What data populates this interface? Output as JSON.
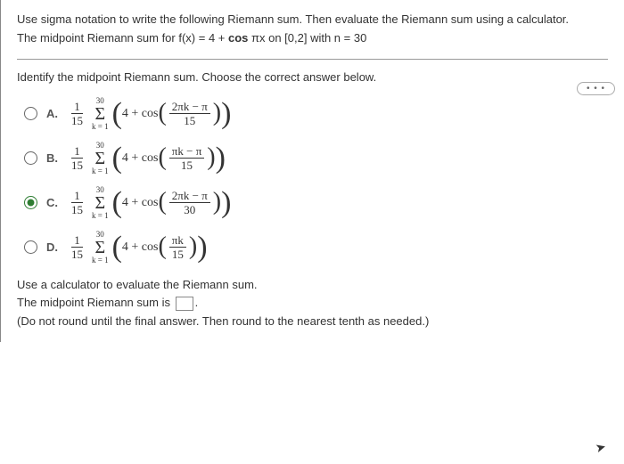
{
  "problem": {
    "line1": "Use sigma notation to write the following Riemann sum. Then evaluate the Riemann sum using a calculator.",
    "line2_prefix": "The midpoint Riemann sum for f(x) = 4 + ",
    "line2_cos": "cos",
    "line2_mid": " πx on [0,2] with n = 30"
  },
  "ellipsis": "• • •",
  "instruction": "Identify the midpoint Riemann sum. Choose the correct answer below.",
  "options": [
    {
      "label": "A.",
      "selected": false,
      "coef_num": "1",
      "coef_den": "15",
      "sum_top": "30",
      "sum_bot": "k = 1",
      "inner_prefix": "4 + cos",
      "arg_num": "2πk − π",
      "arg_den": "15"
    },
    {
      "label": "B.",
      "selected": false,
      "coef_num": "1",
      "coef_den": "15",
      "sum_top": "30",
      "sum_bot": "k = 1",
      "inner_prefix": "4 + cos",
      "arg_num": "πk − π",
      "arg_den": "15"
    },
    {
      "label": "C.",
      "selected": true,
      "coef_num": "1",
      "coef_den": "15",
      "sum_top": "30",
      "sum_bot": "k = 1",
      "inner_prefix": "4 + cos",
      "arg_num": "2πk − π",
      "arg_den": "30"
    },
    {
      "label": "D.",
      "selected": false,
      "coef_num": "1",
      "coef_den": "15",
      "sum_top": "30",
      "sum_bot": "k = 1",
      "inner_prefix": "4 + cos",
      "arg_num": "πk",
      "arg_den": "15"
    }
  ],
  "final": {
    "line1": "Use a calculator to evaluate the Riemann sum.",
    "line2_prefix": "The midpoint Riemann sum is ",
    "line2_suffix": ".",
    "line3": "(Do not round until the final answer. Then round to the nearest tenth as needed.)"
  }
}
